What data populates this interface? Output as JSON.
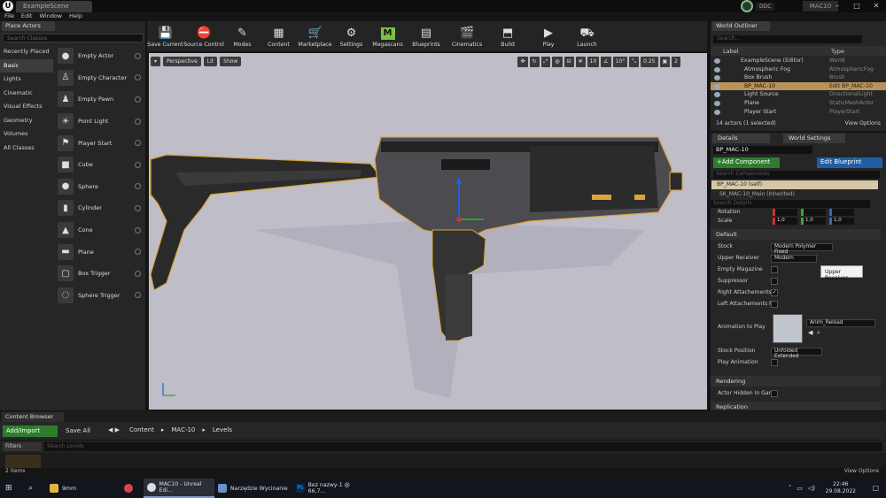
{
  "window": {
    "tab": "ExampleScene",
    "ddc": "DDC",
    "project": "MAC10"
  },
  "menu": [
    "File",
    "Edit",
    "Window",
    "Help"
  ],
  "place_actors": {
    "tab": "Place Actors",
    "search_placeholder": "Search Classes",
    "categories": [
      "Recently Placed",
      "Basic",
      "Lights",
      "Cinematic",
      "Visual Effects",
      "Geometry",
      "Volumes",
      "All Classes"
    ],
    "items": [
      "Empty Actor",
      "Empty Character",
      "Empty Pawn",
      "Point Light",
      "Player Start",
      "Cube",
      "Sphere",
      "Cylinder",
      "Cone",
      "Plane",
      "Box Trigger",
      "Sphere Trigger"
    ]
  },
  "toolbar": [
    "Save Current",
    "Source Control",
    "Modes",
    "Content",
    "Marketplace",
    "Settings",
    "Megascans",
    "Blueprints",
    "Cinematics",
    "Build",
    "Play",
    "Launch"
  ],
  "viewport": {
    "perspective": "Perspective",
    "lit": "Lit",
    "show": "Show",
    "grid": "10",
    "angle": "10°",
    "scale": "0.25",
    "cams": "2"
  },
  "outliner": {
    "tab": "World Outliner",
    "search_placeholder": "Search...",
    "col_label": "Label",
    "col_type": "Type",
    "rows": [
      {
        "label": "ExampleScene (Editor)",
        "type": "World"
      },
      {
        "label": "Atmospheric Fog",
        "type": "AtmosphericFog"
      },
      {
        "label": "Box Brush",
        "type": "Brush"
      },
      {
        "label": "BP_MAC-10",
        "type": "Edit BP_MAC-10"
      },
      {
        "label": "Light Source",
        "type": "DirectionalLight"
      },
      {
        "label": "Plane",
        "type": "StaticMeshActor"
      },
      {
        "label": "Player Start",
        "type": "PlayerStart"
      }
    ],
    "footer": "14 actors (1 selected)",
    "view_options": "View Options"
  },
  "details": {
    "tab": "Details",
    "tab2": "World Settings",
    "actor_name": "BP_MAC-10",
    "add_component": "+Add Component",
    "edit_blueprint": "Edit Blueprint",
    "search_components": "Search Components",
    "self": "BP_MAC-10 (self)",
    "sk_mesh": "SK_MAC-10_Main (Inherited)",
    "search_details": "Search Details",
    "rotation_label": "Rotation",
    "scale_label": "Scale",
    "scale_vals": [
      "1,0",
      "1,0",
      "1,0"
    ],
    "section_default": "Default",
    "stock_label": "Stock",
    "stock_value": "Modern Polymer Fixed",
    "upper_label": "Upper Receiver",
    "upper_value": "Modern",
    "empty_mag": "Empty Magazine",
    "suppressor": "Suppressor",
    "right_att": "Right Attachements R",
    "left_att": "Left Attachements Ra",
    "anim_label": "Animation to Play",
    "anim_value": "Anim_Reload",
    "stock_pos_label": "Stock Position",
    "stock_pos_value": "Unfolded Extended",
    "play_anim": "Play Animation",
    "section_rendering": "Rendering",
    "actor_hidden": "Actor Hidden In Game",
    "section_replication": "Replication",
    "tooltip": "Upper Receiver"
  },
  "content_browser": {
    "tab": "Content Browser",
    "add_import": "Add/Import",
    "save_all": "Save All",
    "crumbs": [
      "Content",
      "MAC-10",
      "Levels"
    ],
    "filters": "Filters",
    "search_placeholder": "Search Levels",
    "items_count": "2 items",
    "view_options": "View Options"
  },
  "taskbar": {
    "apps": [
      "9mm",
      "MAC10 - Unreal Edi...",
      "Narzędzie Wycinanie",
      "Bez nazwy-1 @ 66,7..."
    ],
    "time": "22:46",
    "date": "29.08.2022"
  }
}
